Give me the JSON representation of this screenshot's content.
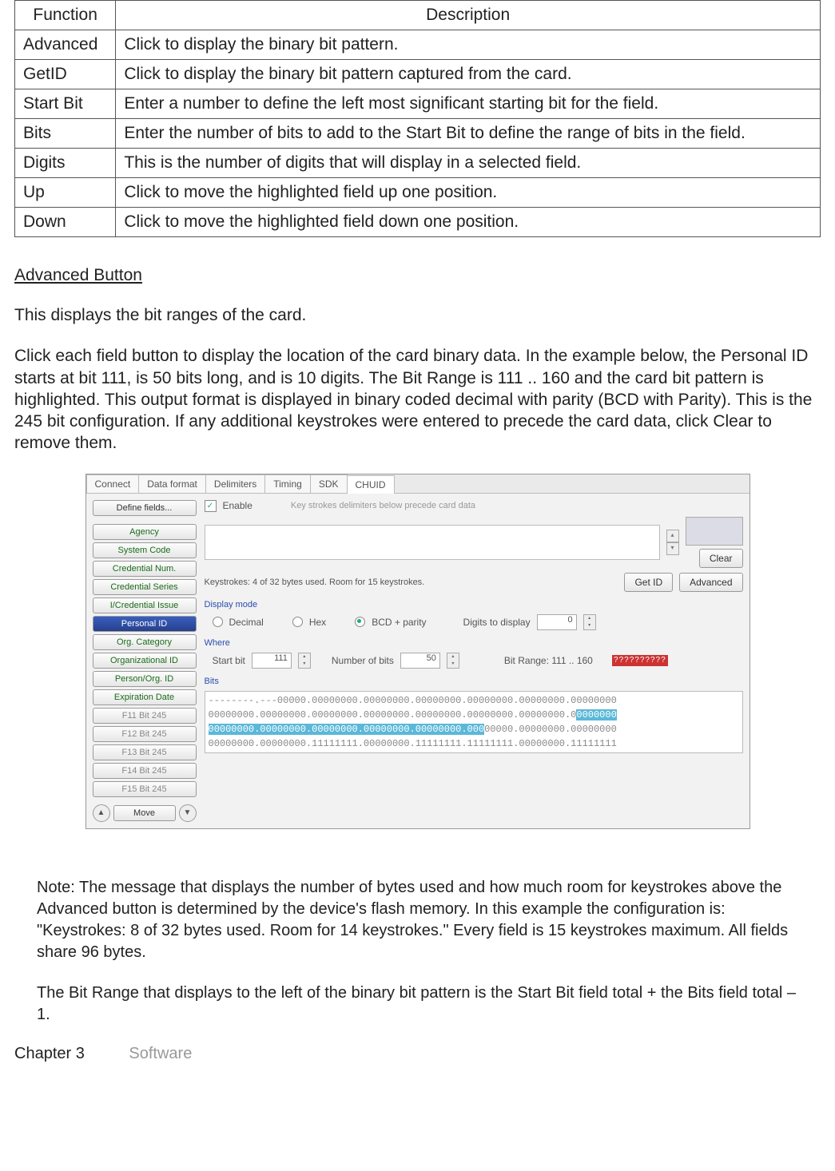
{
  "table": {
    "headers": [
      "Function",
      "Description"
    ],
    "rows": [
      [
        "Advanced",
        "Click to display the binary bit pattern."
      ],
      [
        "GetID",
        "Click to display the binary bit pattern captured from the card."
      ],
      [
        "Start Bit",
        "Enter a number to define the left most significant starting bit for the field."
      ],
      [
        "Bits",
        "Enter the number of bits to add to the Start Bit to define the range of bits in the field."
      ],
      [
        "Digits",
        "This is the number of digits that will display in a selected field."
      ],
      [
        "Up",
        "Click to move the highlighted field up one position."
      ],
      [
        "Down",
        "Click to move the highlighted field down one position."
      ]
    ]
  },
  "heading": "Advanced Button",
  "para1": "This displays the bit ranges of the card.",
  "para2": "Click each field button to display the location of the card binary data. In the example below, the Personal ID starts at bit 111, is 50 bits long, and is 10 digits. The Bit Range is 111 .. 160 and the card bit pattern is highlighted. This output format is displayed in binary coded decimal with parity (BCD with Parity). This is the 245 bit configuration. If any additional keystrokes were entered to precede the card data, click Clear to remove them.",
  "shot": {
    "tabs": [
      "Connect",
      "Data format",
      "Delimiters",
      "Timing",
      "SDK",
      "CHUID"
    ],
    "activeTab": 5,
    "sidebar": {
      "define": "Define fields...",
      "items": [
        "Agency",
        "System Code",
        "Credential Num.",
        "Credential Series",
        "I/Credential Issue",
        "Personal ID",
        "Org. Category",
        "Organizational ID",
        "Person/Org. ID",
        "Expiration Date",
        "F11 Bit 245",
        "F12 Bit 245",
        "F13 Bit 245",
        "F14 Bit 245",
        "F15 Bit 245"
      ],
      "selected": 5,
      "move": "Move"
    },
    "enable": {
      "label": "Enable",
      "hint": "Key strokes delimiters below precede card data"
    },
    "clear": "Clear",
    "status": "Keystrokes: 4 of 32 bytes used. Room for 15 keystrokes.",
    "getid": "Get ID",
    "advanced": "Advanced",
    "display": {
      "title": "Display mode",
      "decimal": "Decimal",
      "hex": "Hex",
      "bcd": "BCD + parity",
      "digits_lbl": "Digits to display",
      "digits_val": "0"
    },
    "where": {
      "title": "Where",
      "startbit_lbl": "Start bit",
      "startbit_val": "111",
      "numbits_lbl": "Number of bits",
      "numbits_val": "50",
      "range": "Bit Range: 111 .. 160",
      "redq": "??????????"
    },
    "bits": {
      "title": "Bits",
      "line1a": "--------.---00000.00000000.00000000.00000000.00000000.00000000.00000000",
      "line2a": "00000000.00000000.00000000.00000000.00000000.00000000.00000000.0",
      "line2b": "0000000",
      "line3a": "00000000.00000000.00000000.00000000.00000000.000",
      "line3b": "00000.00000000.00000000",
      "line4a": "00000000.00000000.11111111.00000000.11111111.11111111.00000000.11111111"
    }
  },
  "notes": {
    "p1": "Note: The message that displays the number of bytes used and how much room for keystrokes above the Advanced button is determined by the device's flash memory. In this example the configuration is: \"Keystrokes: 8 of 32 bytes used. Room for 14 keystrokes.\" Every field is 15 keystrokes maximum. All fields share 96 bytes.",
    "p2": "The Bit Range that displays to the left of the binary bit pattern is the Start Bit field total + the Bits field total – 1."
  },
  "footer": {
    "chapter": "Chapter 3",
    "section": "Software"
  }
}
